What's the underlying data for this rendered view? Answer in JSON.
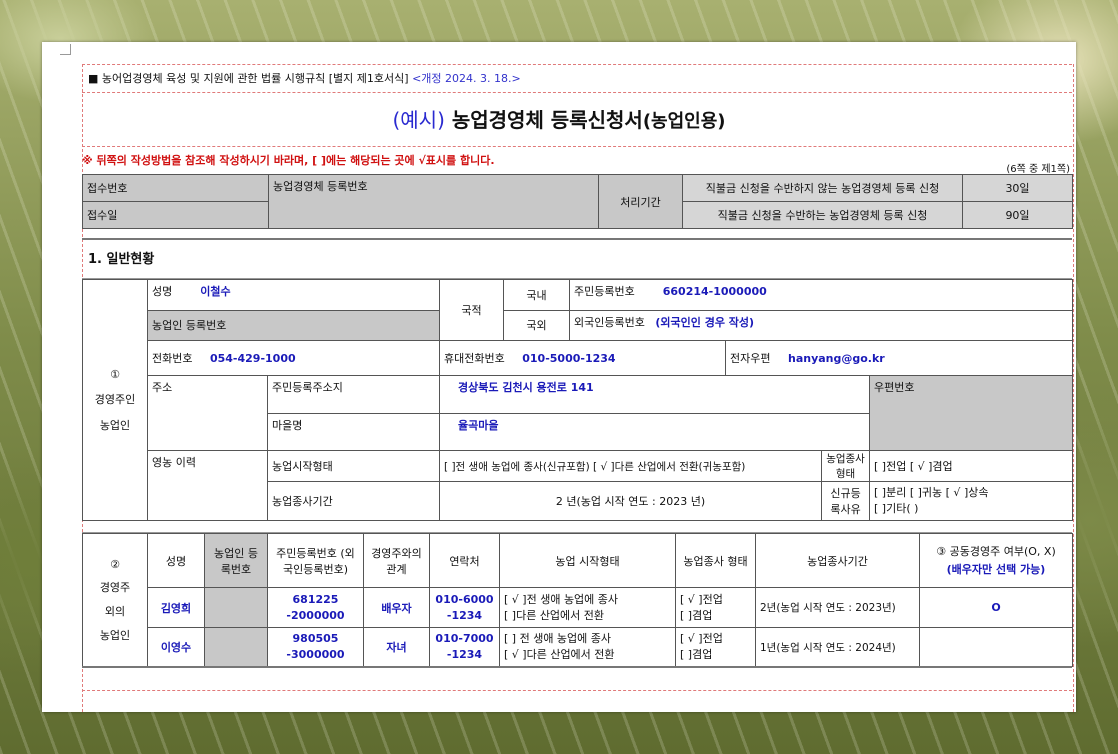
{
  "header": {
    "law": "■ 농어업경영체 육성 및 지원에 관한 법률 시행규칙 [별지 제1호서식]",
    "revision": "<개정 2024. 3. 18.>",
    "title_example": "(예시)",
    "title_main": "농업경영체 등록신청서",
    "title_sub": "(농업인용)",
    "notice": "※ 뒤쪽의 작성방법을 참조해 작성하시기 바라며, [ ]에는 해당되는 곳에 √표시를 합니다.",
    "page_of": "(6쪽 중 제1쪽)"
  },
  "receipt": {
    "receipt_no": "접수번호",
    "receipt_date": "접수일",
    "reg_no": "농업경영체 등록번호",
    "processing": "처리기간",
    "without_subsidy": "직불금 신청을 수반하지 않는 농업경영체 등록 신청",
    "without_days": "30일",
    "with_subsidy": "직불금 신청을 수반하는 농업경영체 등록 신청",
    "with_days": "90일"
  },
  "section1": {
    "title": "1. 일반현황"
  },
  "owner": {
    "label": [
      "①",
      "경영주인",
      "농업인"
    ],
    "name_label": "성명",
    "name": "이철수",
    "nationality": "국적",
    "domestic": "국내",
    "foreign": "국외",
    "rrn_label": "주민등록번호",
    "rrn": "660214-1000000",
    "foreign_label": "외국인등록번호",
    "foreign_value": "(외국인인 경우 작성)",
    "farmer_reg_label": "농업인 등록번호",
    "phone_label": "전화번호",
    "phone": "054-429-1000",
    "mobile_label": "휴대전화번호",
    "mobile": "010-5000-1234",
    "email_label": "전자우편",
    "email": "hanyang@go.kr",
    "address_label": "주소",
    "resident_addr_label": "주민등록주소지",
    "resident_addr": "경상북도 김천시 용전로 141",
    "zip_label": "우편번호",
    "village_label": "마을명",
    "village": "율곡마을",
    "career_label": "영농 이력",
    "start_type_label": "농업시작형태",
    "start_type_value": "[ ]전 생애 농업에 종사(신규포함) [ √ ]다른 산업에서 전환(귀농포함)",
    "work_type_label": "농업종사형태",
    "work_type_value": "[ ]전업 [ √ ]겸업",
    "period_label": "농업종사기간",
    "period_value": "2 년(농업 시작 연도 : 2023 년)",
    "new_reason_label": "신규등록사유",
    "new_reason_value1": "[ ]분리 [ ]귀농 [ √ ]상속",
    "new_reason_value2": "[ ]기타(          )"
  },
  "others": {
    "label": [
      "②",
      "경영주",
      "외의",
      "농업인"
    ],
    "headers": {
      "name": "성명",
      "farmer_reg": "농업인 등록번호",
      "rrn": "주민등록번호 (외국인등록번호)",
      "relation": "경영주와의 관계",
      "contact": "연락처",
      "start_type": "농업 시작형태",
      "work_type": "농업종사 형태",
      "period": "농업종사기간",
      "co_owner": "③ 공동경영주 여부(O, X)",
      "co_owner_note": "(배우자만 선택 가능)"
    },
    "rows": [
      {
        "name": "김영희",
        "rrn1": "681225",
        "rrn2": "-2000000",
        "relation": "배우자",
        "contact1": "010-6000",
        "contact2": "-1234",
        "start1": "[ √ ]전 생애 농업에 종사",
        "start2": "[ ]다른 산업에서 전환",
        "work1": "[ √ ]전업",
        "work2": "[ ]겸업",
        "period": "2년(농업 시작 연도 : 2023년)",
        "co_owner": "O"
      },
      {
        "name": "이영수",
        "rrn1": "980505",
        "rrn2": "-3000000",
        "relation": "자녀",
        "contact1": "010-7000",
        "contact2": "-1234",
        "start1": "[ ] 전 생애 농업에 종사",
        "start2": "[ √ ]다른 산업에서 전환",
        "work1": "[ √ ]전업",
        "work2": "[ ]겸업",
        "period": "1년(농업 시작 연도 : 2024년)",
        "co_owner": ""
      }
    ]
  },
  "colors": {
    "blue": "#1a1ab8",
    "red": "#d01010",
    "gray": "#c8c8c8"
  }
}
